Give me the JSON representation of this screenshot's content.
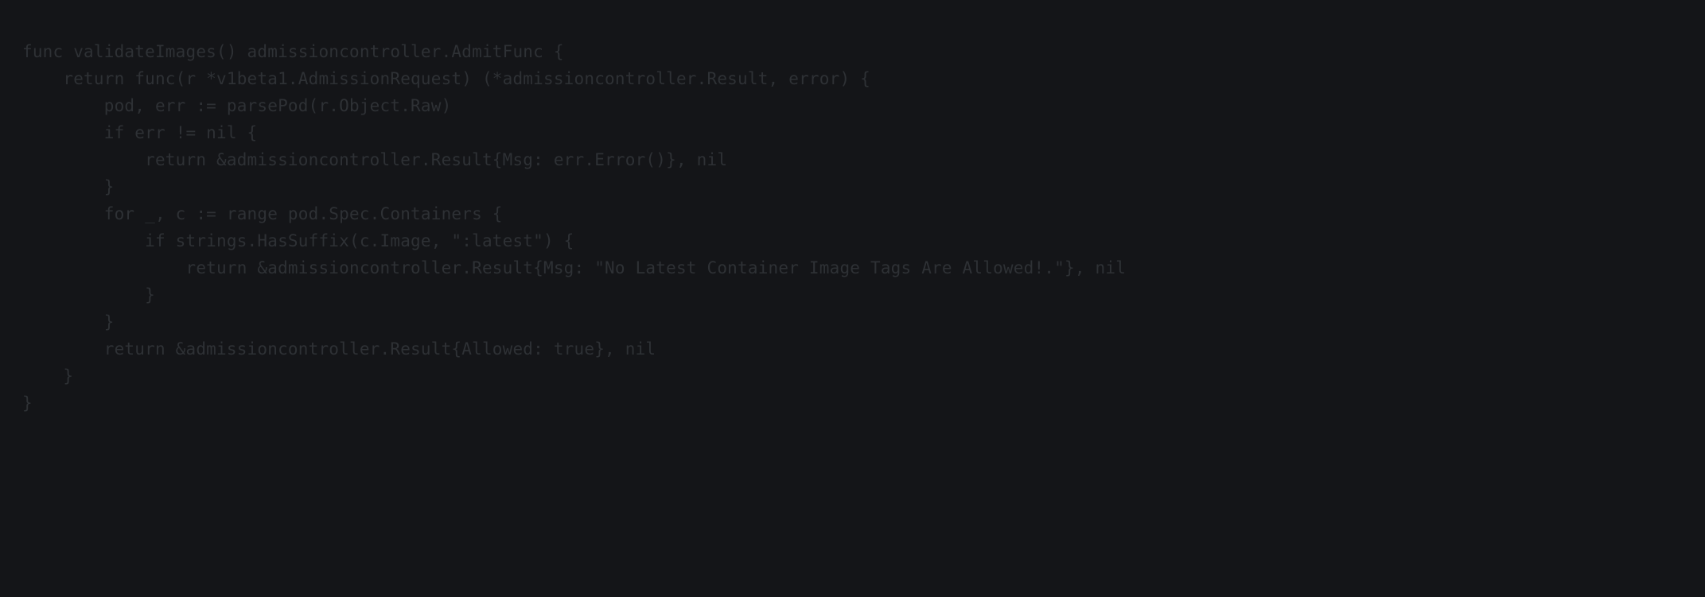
{
  "code": {
    "lines": [
      "func validateImages() admissioncontroller.AdmitFunc {",
      "    return func(r *v1beta1.AdmissionRequest) (*admissioncontroller.Result, error) {",
      "        pod, err := parsePod(r.Object.Raw)",
      "        if err != nil {",
      "            return &admissioncontroller.Result{Msg: err.Error()}, nil",
      "        }",
      "        for _, c := range pod.Spec.Containers {",
      "            if strings.HasSuffix(c.Image, \":latest\") {",
      "                return &admissioncontroller.Result{Msg: \"No Latest Container Image Tags Are Allowed!.\"}, nil",
      "            }",
      "        }",
      "        return &admissioncontroller.Result{Allowed: true}, nil",
      "    }",
      "}"
    ]
  }
}
